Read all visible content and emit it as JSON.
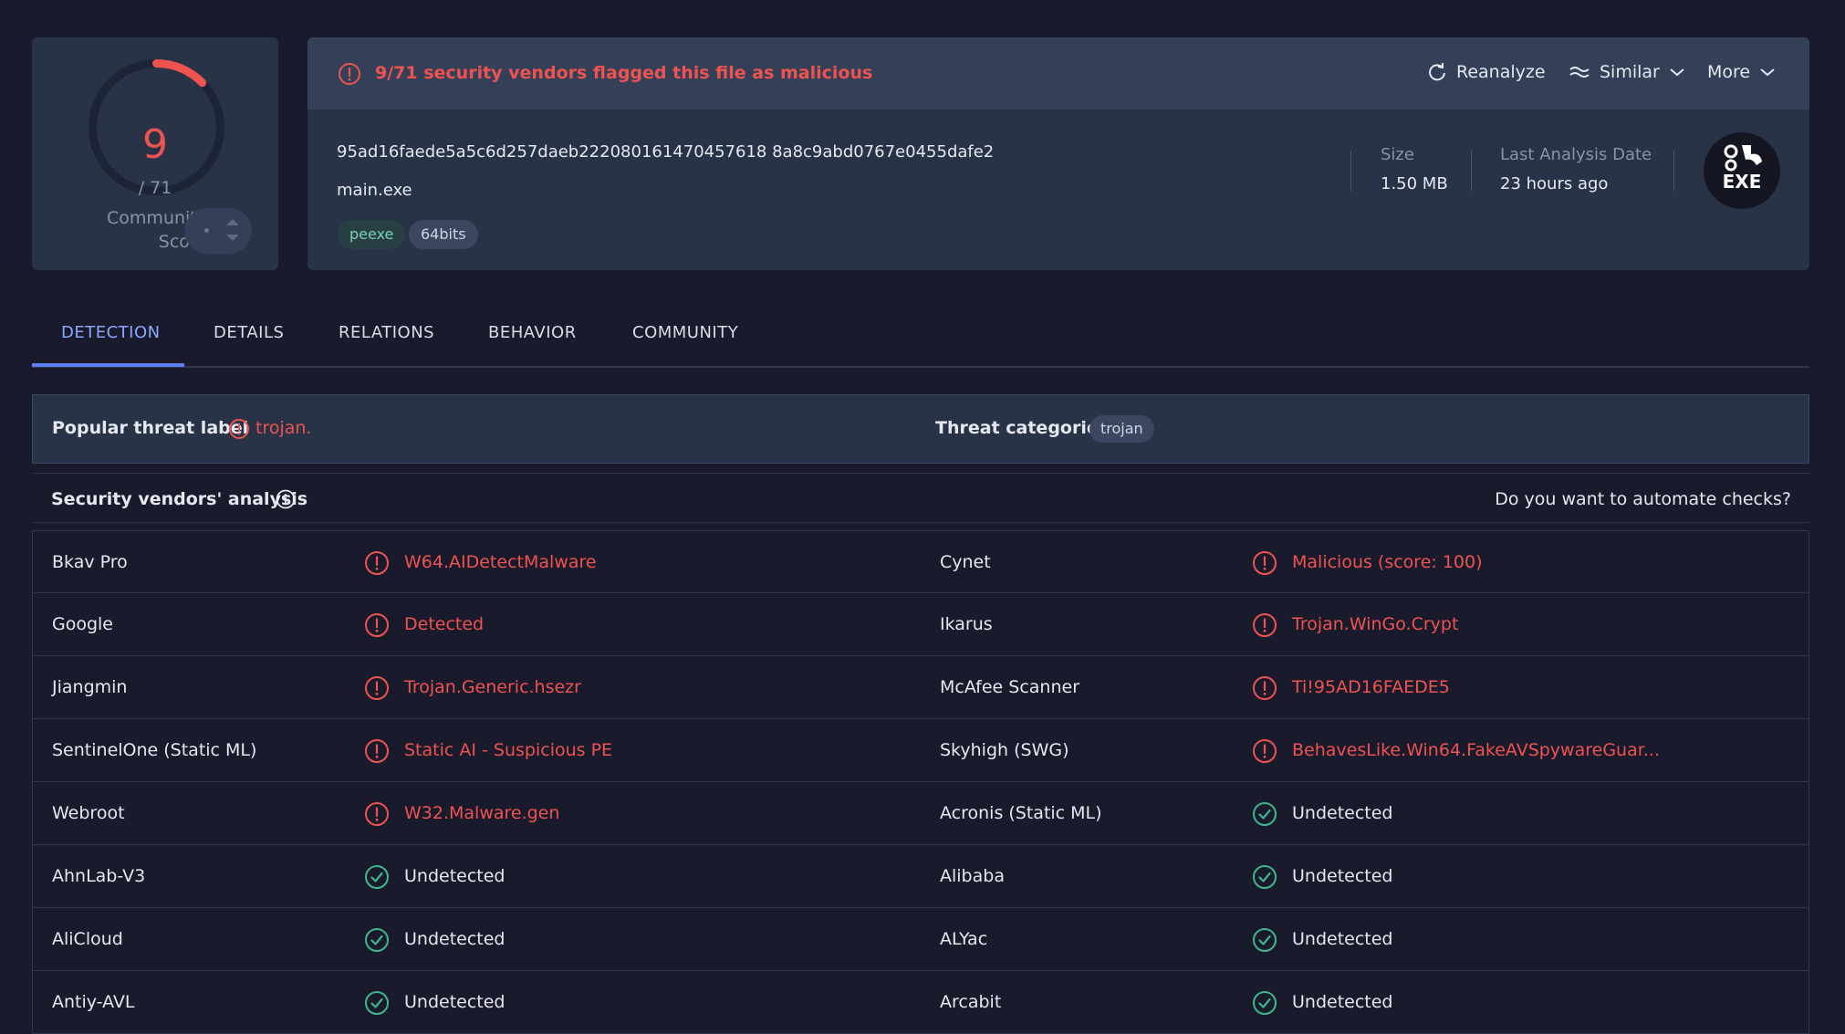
{
  "score": {
    "detections": "9",
    "total": "/ 71",
    "detection_fraction": 0.127,
    "community_label": "Community Score",
    "vote_value": "-"
  },
  "alert": {
    "text": "9/71 security vendors flagged this file as malicious",
    "reanalyze_label": "Reanalyze",
    "similar_label": "Similar",
    "more_label": "More"
  },
  "file": {
    "hash": "95ad16faede5a5c6d257daeb222080161470457618 8a8c9abd0767e0455dafe2",
    "name": "main.exe",
    "tags": [
      "peexe",
      "64bits"
    ],
    "size_label": "Size",
    "size_value": "1.50 MB",
    "date_label": "Last Analysis Date",
    "date_value": "23 hours ago",
    "type_badge": "EXE"
  },
  "tabs": [
    "DETECTION",
    "DETAILS",
    "RELATIONS",
    "BEHAVIOR",
    "COMMUNITY"
  ],
  "threat": {
    "popular_label": "Popular threat label",
    "popular_value": "trojan.",
    "categories_label": "Threat categories",
    "categories_value": "trojan"
  },
  "vendors_header": {
    "title": "Security vendors' analysis",
    "automate_link": "Do you want to automate checks?"
  },
  "vendors": [
    {
      "left": {
        "name": "Bkav Pro",
        "result": "W64.AIDetectMalware",
        "status": "malicious"
      },
      "right": {
        "name": "Cynet",
        "result": "Malicious (score: 100)",
        "status": "malicious"
      }
    },
    {
      "left": {
        "name": "Google",
        "result": "Detected",
        "status": "malicious"
      },
      "right": {
        "name": "Ikarus",
        "result": "Trojan.WinGo.Crypt",
        "status": "malicious"
      }
    },
    {
      "left": {
        "name": "Jiangmin",
        "result": "Trojan.Generic.hsezr",
        "status": "malicious"
      },
      "right": {
        "name": "McAfee Scanner",
        "result": "Ti!95AD16FAEDE5",
        "status": "malicious"
      }
    },
    {
      "left": {
        "name": "SentinelOne (Static ML)",
        "result": "Static AI - Suspicious PE",
        "status": "malicious"
      },
      "right": {
        "name": "Skyhigh (SWG)",
        "result": "BehavesLike.Win64.FakeAVSpywareGuar...",
        "status": "malicious"
      }
    },
    {
      "left": {
        "name": "Webroot",
        "result": "W32.Malware.gen",
        "status": "malicious"
      },
      "right": {
        "name": "Acronis (Static ML)",
        "result": "Undetected",
        "status": "undetected"
      }
    },
    {
      "left": {
        "name": "AhnLab-V3",
        "result": "Undetected",
        "status": "undetected"
      },
      "right": {
        "name": "Alibaba",
        "result": "Undetected",
        "status": "undetected"
      }
    },
    {
      "left": {
        "name": "AliCloud",
        "result": "Undetected",
        "status": "undetected"
      },
      "right": {
        "name": "ALYac",
        "result": "Undetected",
        "status": "undetected"
      }
    },
    {
      "left": {
        "name": "Antiy-AVL",
        "result": "Undetected",
        "status": "undetected"
      },
      "right": {
        "name": "Arcabit",
        "result": "Undetected",
        "status": "undetected"
      }
    }
  ],
  "colors": {
    "malicious": "#ef5350",
    "undetected": "#3fb68b",
    "accent": "#8ba7ff"
  }
}
